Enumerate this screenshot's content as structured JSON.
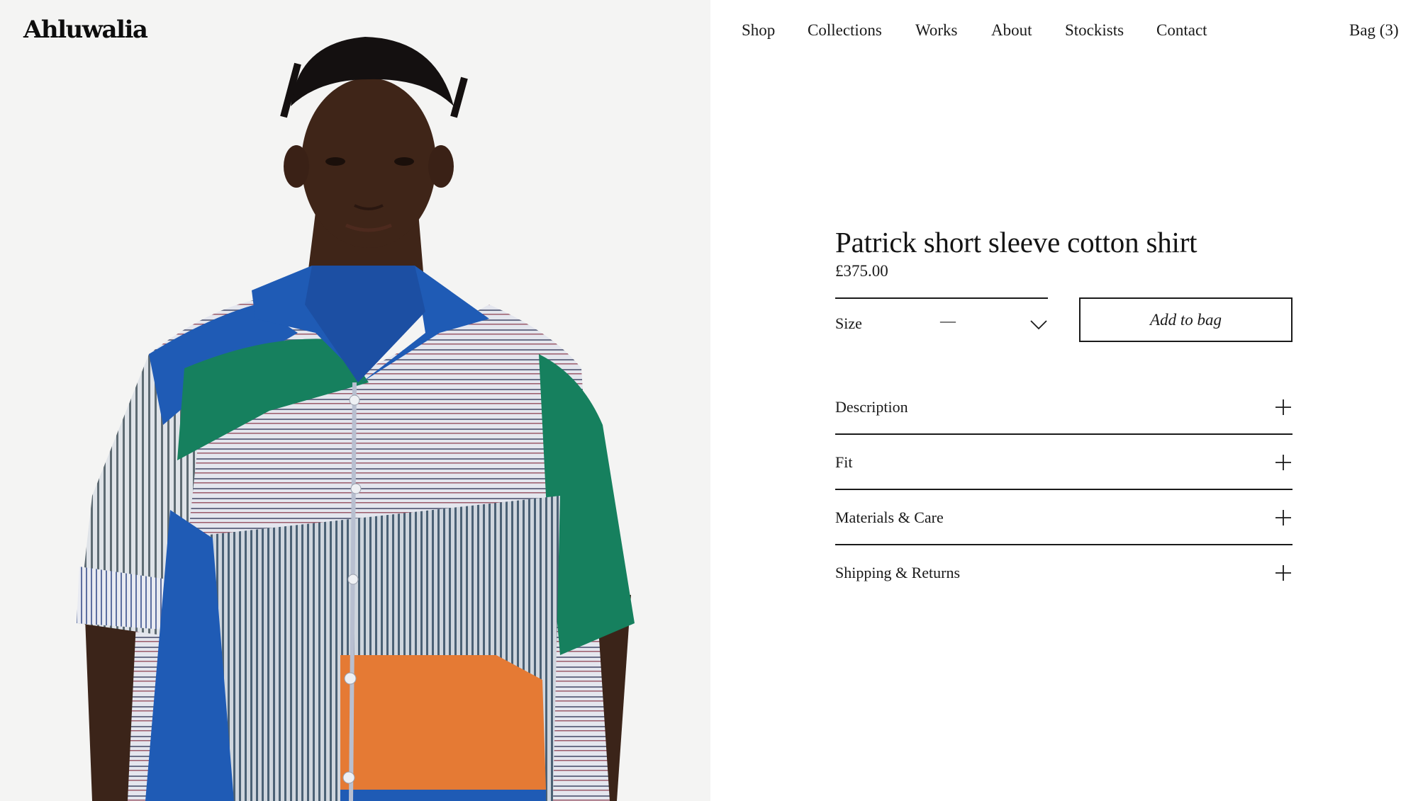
{
  "brand": {
    "logo_text": "Ahluwalia"
  },
  "nav": {
    "items": [
      {
        "label": "Shop"
      },
      {
        "label": "Collections"
      },
      {
        "label": "Works"
      },
      {
        "label": "About"
      },
      {
        "label": "Stockists"
      },
      {
        "label": "Contact"
      }
    ],
    "bag_label": "Bag (3)"
  },
  "product": {
    "title": "Patrick short sleeve cotton shirt",
    "price": "£375.00",
    "size": {
      "label": "Size",
      "selected": "—"
    },
    "add_to_bag_label": "Add to bag",
    "accordion": [
      {
        "label": "Description"
      },
      {
        "label": "Fit"
      },
      {
        "label": "Materials & Care"
      },
      {
        "label": "Shipping & Returns"
      }
    ]
  },
  "colors": {
    "text": "#1a1a1a",
    "photo_background": "#f4f4f3",
    "shirt_blue": "#1f5bb5",
    "shirt_green": "#16805e",
    "shirt_orange": "#e57a34"
  },
  "icons": {
    "size_dropdown": "chevron-down-icon",
    "accordion_toggle": "plus-icon"
  }
}
